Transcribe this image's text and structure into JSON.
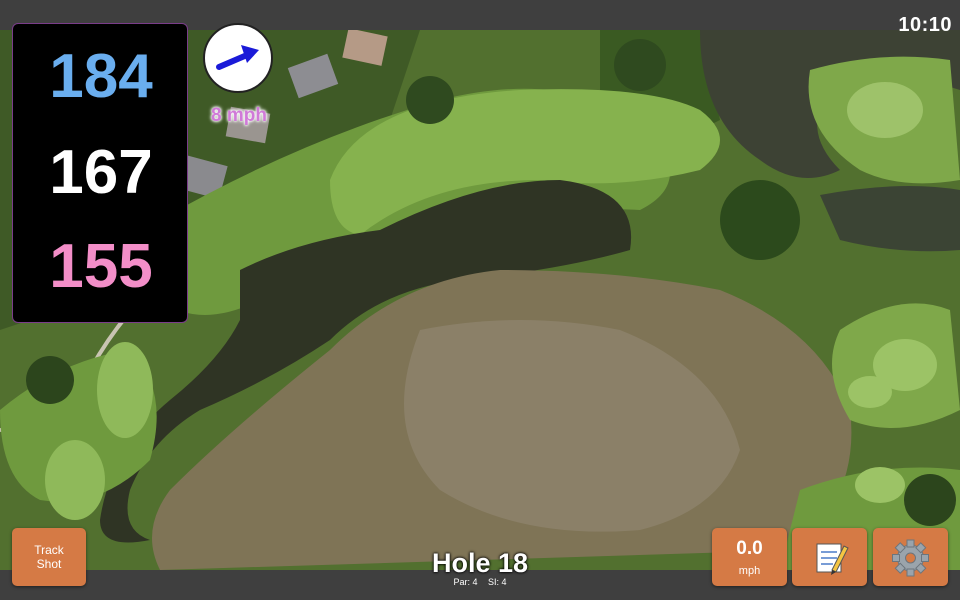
{
  "status": {
    "clock": "10:10"
  },
  "yardages": {
    "back": "184",
    "middle": "167",
    "front": "155"
  },
  "wind": {
    "speed": "8 mph",
    "icon": "wind-arrow-icon"
  },
  "hole": {
    "title": "Hole 18",
    "par": "Par: 4",
    "si": "SI: 4"
  },
  "buttons": {
    "track_shot_line1": "Track",
    "track_shot_line2": "Shot",
    "speed_value": "0.0",
    "speed_unit": "mph",
    "notes_icon": "notepad-icon",
    "settings_icon": "gear-icon"
  },
  "colors": {
    "back_yardage": "#6aaeef",
    "middle_yardage": "#ffffff",
    "front_yardage": "#f38ec8",
    "button": "#d57a45",
    "bar": "#3f3f3f"
  }
}
